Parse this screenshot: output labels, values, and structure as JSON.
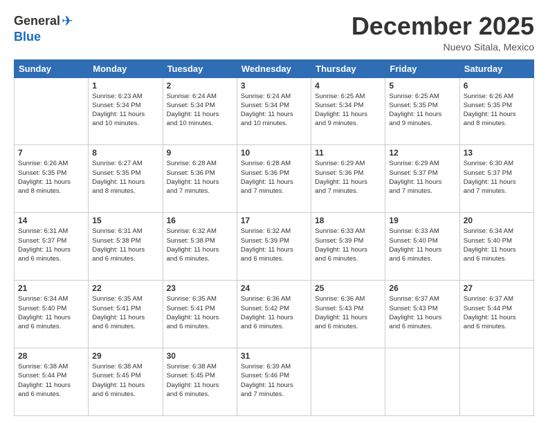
{
  "header": {
    "logo_general": "General",
    "logo_blue": "Blue",
    "month": "December 2025",
    "location": "Nuevo Sitala, Mexico"
  },
  "days_of_week": [
    "Sunday",
    "Monday",
    "Tuesday",
    "Wednesday",
    "Thursday",
    "Friday",
    "Saturday"
  ],
  "weeks": [
    [
      {
        "day": "",
        "info": ""
      },
      {
        "day": "1",
        "info": "Sunrise: 6:23 AM\nSunset: 5:34 PM\nDaylight: 11 hours\nand 10 minutes."
      },
      {
        "day": "2",
        "info": "Sunrise: 6:24 AM\nSunset: 5:34 PM\nDaylight: 11 hours\nand 10 minutes."
      },
      {
        "day": "3",
        "info": "Sunrise: 6:24 AM\nSunset: 5:34 PM\nDaylight: 11 hours\nand 10 minutes."
      },
      {
        "day": "4",
        "info": "Sunrise: 6:25 AM\nSunset: 5:34 PM\nDaylight: 11 hours\nand 9 minutes."
      },
      {
        "day": "5",
        "info": "Sunrise: 6:25 AM\nSunset: 5:35 PM\nDaylight: 11 hours\nand 9 minutes."
      },
      {
        "day": "6",
        "info": "Sunrise: 6:26 AM\nSunset: 5:35 PM\nDaylight: 11 hours\nand 8 minutes."
      }
    ],
    [
      {
        "day": "7",
        "info": "Sunrise: 6:26 AM\nSunset: 5:35 PM\nDaylight: 11 hours\nand 8 minutes."
      },
      {
        "day": "8",
        "info": "Sunrise: 6:27 AM\nSunset: 5:35 PM\nDaylight: 11 hours\nand 8 minutes."
      },
      {
        "day": "9",
        "info": "Sunrise: 6:28 AM\nSunset: 5:36 PM\nDaylight: 11 hours\nand 7 minutes."
      },
      {
        "day": "10",
        "info": "Sunrise: 6:28 AM\nSunset: 5:36 PM\nDaylight: 11 hours\nand 7 minutes."
      },
      {
        "day": "11",
        "info": "Sunrise: 6:29 AM\nSunset: 5:36 PM\nDaylight: 11 hours\nand 7 minutes."
      },
      {
        "day": "12",
        "info": "Sunrise: 6:29 AM\nSunset: 5:37 PM\nDaylight: 11 hours\nand 7 minutes."
      },
      {
        "day": "13",
        "info": "Sunrise: 6:30 AM\nSunset: 5:37 PM\nDaylight: 11 hours\nand 7 minutes."
      }
    ],
    [
      {
        "day": "14",
        "info": "Sunrise: 6:31 AM\nSunset: 5:37 PM\nDaylight: 11 hours\nand 6 minutes."
      },
      {
        "day": "15",
        "info": "Sunrise: 6:31 AM\nSunset: 5:38 PM\nDaylight: 11 hours\nand 6 minutes."
      },
      {
        "day": "16",
        "info": "Sunrise: 6:32 AM\nSunset: 5:38 PM\nDaylight: 11 hours\nand 6 minutes."
      },
      {
        "day": "17",
        "info": "Sunrise: 6:32 AM\nSunset: 5:39 PM\nDaylight: 11 hours\nand 6 minutes."
      },
      {
        "day": "18",
        "info": "Sunrise: 6:33 AM\nSunset: 5:39 PM\nDaylight: 11 hours\nand 6 minutes."
      },
      {
        "day": "19",
        "info": "Sunrise: 6:33 AM\nSunset: 5:40 PM\nDaylight: 11 hours\nand 6 minutes."
      },
      {
        "day": "20",
        "info": "Sunrise: 6:34 AM\nSunset: 5:40 PM\nDaylight: 11 hours\nand 6 minutes."
      }
    ],
    [
      {
        "day": "21",
        "info": "Sunrise: 6:34 AM\nSunset: 5:40 PM\nDaylight: 11 hours\nand 6 minutes."
      },
      {
        "day": "22",
        "info": "Sunrise: 6:35 AM\nSunset: 5:41 PM\nDaylight: 11 hours\nand 6 minutes."
      },
      {
        "day": "23",
        "info": "Sunrise: 6:35 AM\nSunset: 5:41 PM\nDaylight: 11 hours\nand 6 minutes."
      },
      {
        "day": "24",
        "info": "Sunrise: 6:36 AM\nSunset: 5:42 PM\nDaylight: 11 hours\nand 6 minutes."
      },
      {
        "day": "25",
        "info": "Sunrise: 6:36 AM\nSunset: 5:43 PM\nDaylight: 11 hours\nand 6 minutes."
      },
      {
        "day": "26",
        "info": "Sunrise: 6:37 AM\nSunset: 5:43 PM\nDaylight: 11 hours\nand 6 minutes."
      },
      {
        "day": "27",
        "info": "Sunrise: 6:37 AM\nSunset: 5:44 PM\nDaylight: 11 hours\nand 6 minutes."
      }
    ],
    [
      {
        "day": "28",
        "info": "Sunrise: 6:38 AM\nSunset: 5:44 PM\nDaylight: 11 hours\nand 6 minutes."
      },
      {
        "day": "29",
        "info": "Sunrise: 6:38 AM\nSunset: 5:45 PM\nDaylight: 11 hours\nand 6 minutes."
      },
      {
        "day": "30",
        "info": "Sunrise: 6:38 AM\nSunset: 5:45 PM\nDaylight: 11 hours\nand 6 minutes."
      },
      {
        "day": "31",
        "info": "Sunrise: 6:39 AM\nSunset: 5:46 PM\nDaylight: 11 hours\nand 7 minutes."
      },
      {
        "day": "",
        "info": ""
      },
      {
        "day": "",
        "info": ""
      },
      {
        "day": "",
        "info": ""
      }
    ]
  ]
}
